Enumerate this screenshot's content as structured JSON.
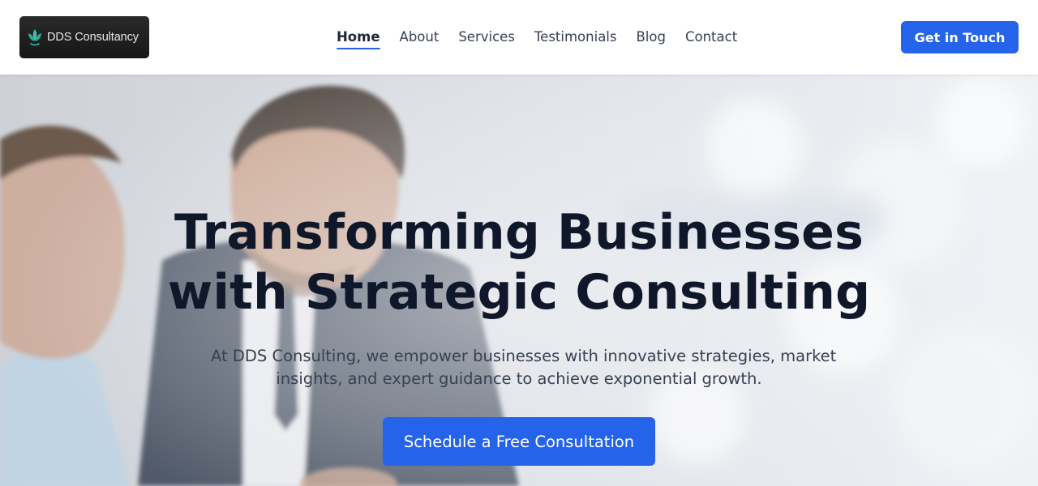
{
  "header": {
    "logo_text": "DDS Consultancy",
    "logo_icon": "lotus-leaf-icon",
    "nav": [
      {
        "label": "Home",
        "active": true
      },
      {
        "label": "About",
        "active": false
      },
      {
        "label": "Services",
        "active": false
      },
      {
        "label": "Testimonials",
        "active": false
      },
      {
        "label": "Blog",
        "active": false
      },
      {
        "label": "Contact",
        "active": false
      }
    ],
    "cta_label": "Get in Touch"
  },
  "hero": {
    "title_line1": "Transforming Businesses",
    "title_line2": "with Strategic Consulting",
    "subtitle_line1": "At DDS Consulting, we empower businesses with innovative strategies, market",
    "subtitle_line2": "insights, and expert guidance to achieve exponential growth.",
    "cta_label": "Schedule a Free Consultation",
    "background": "business-meeting-photo"
  },
  "colors": {
    "accent": "#2563eb",
    "heading": "#0f172a",
    "text": "#374151",
    "logo_bg": "#1f1f1f",
    "logo_icon": "#3fbfb0"
  }
}
